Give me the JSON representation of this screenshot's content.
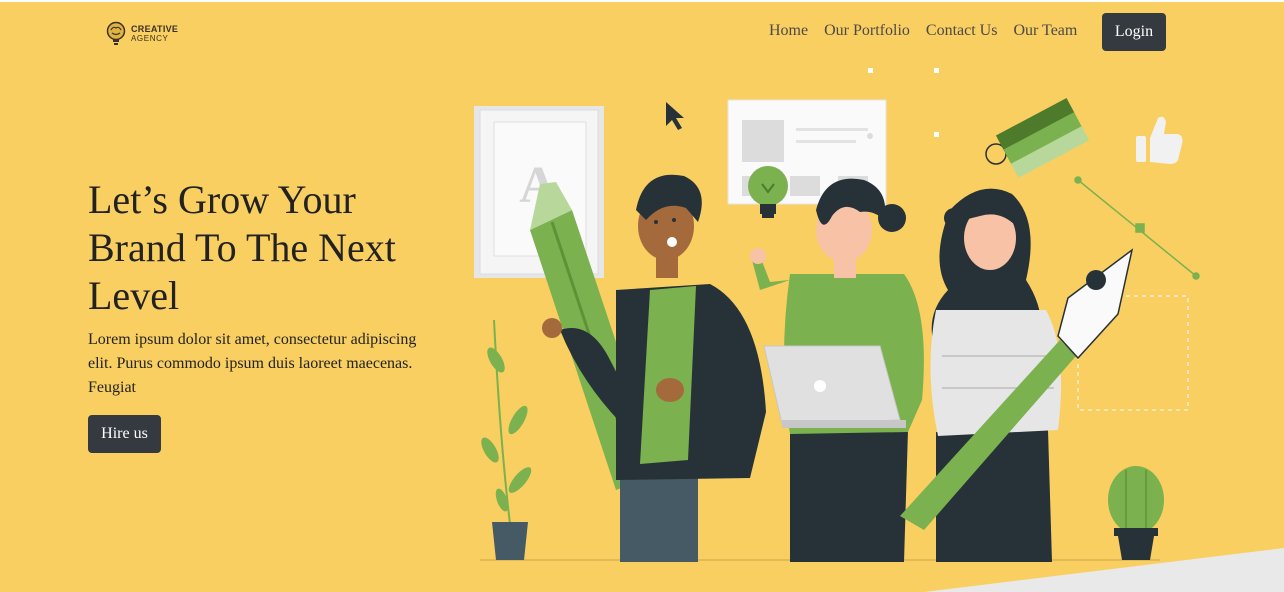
{
  "brand": {
    "line1": "CREATIVE",
    "line2": "AGENCY"
  },
  "nav": {
    "items": [
      {
        "label": "Home"
      },
      {
        "label": "Our Portfolio"
      },
      {
        "label": "Contact Us"
      },
      {
        "label": "Our Team"
      }
    ],
    "login_label": "Login"
  },
  "hero": {
    "title": "Let’s Grow Your Brand To The Next Level",
    "text": "Lorem ipsum dolor sit amet, consectetur adipiscing elit. Purus commodo ipsum duis laoreet maecenas. Feugiat",
    "cta_label": "Hire us",
    "illustration_letter": "A"
  },
  "colors": {
    "background": "#f9cf61",
    "button": "#353a40",
    "accent_green": "#7bb14e",
    "dark": "#263238"
  }
}
